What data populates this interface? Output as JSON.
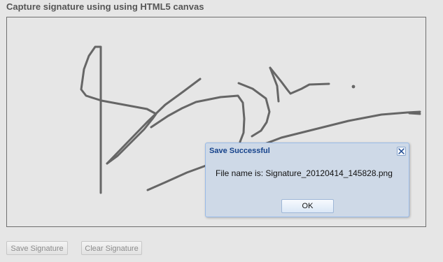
{
  "page": {
    "title": "Capture signature using using HTML5 canvas"
  },
  "canvas": {
    "stroke_color": "#666666",
    "background_color": "#e6e6e6"
  },
  "buttons": {
    "save_label": "Save Signature",
    "clear_label": "Clear Signature"
  },
  "dialog": {
    "title": "Save Successful",
    "message": "File name is: Signature_20120414_145828.png",
    "ok_label": "OK",
    "title_color": "#15428b",
    "background_color": "#ced9e7",
    "border_color": "#99bbe8",
    "close_icon": "close-icon"
  }
}
